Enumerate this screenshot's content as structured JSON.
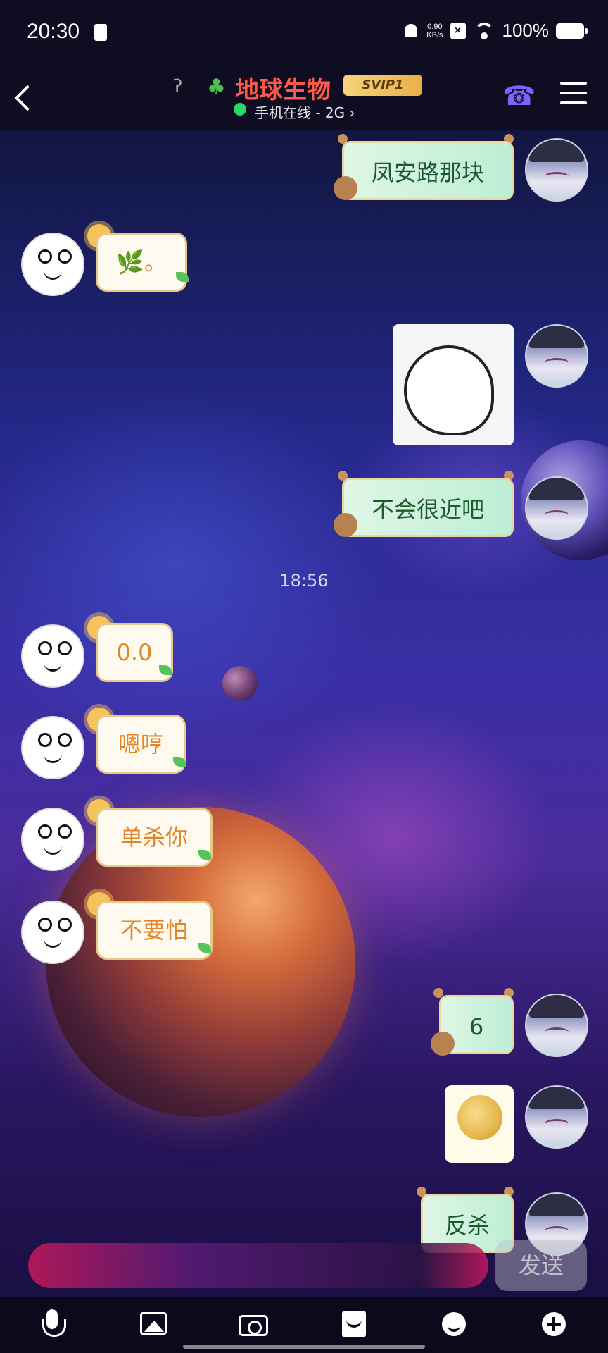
{
  "status_bar": {
    "time": "20:30",
    "net_speed_value": "0.90",
    "net_speed_unit": "KB/s",
    "battery": "100%"
  },
  "header": {
    "title": "地球生物",
    "badge": "SVIP1",
    "presence": "手机在线 - 2G ›",
    "presence_color": "#2ed36d",
    "title_color": "#ff5a4a"
  },
  "messages": [
    {
      "side": "right",
      "type": "text",
      "text": "凤安路那块"
    },
    {
      "side": "left",
      "type": "text",
      "text": "🌿。"
    },
    {
      "side": "right",
      "type": "sticker",
      "description": "sticker-image"
    },
    {
      "side": "right",
      "type": "text",
      "text": "不会很近吧"
    },
    {
      "side": "left",
      "type": "text",
      "text": "0.0"
    },
    {
      "side": "left",
      "type": "text",
      "text": "嗯哼"
    },
    {
      "side": "left",
      "type": "text",
      "text": "单杀你"
    },
    {
      "side": "left",
      "type": "text",
      "text": "不要怕"
    },
    {
      "side": "right",
      "type": "text",
      "text": "6"
    },
    {
      "side": "right",
      "type": "sticker",
      "description": "sticker-image"
    },
    {
      "side": "right",
      "type": "text",
      "text": "反杀"
    }
  ],
  "timestamp": "18:56",
  "composer": {
    "send_label": "发送"
  },
  "toolbar": {
    "icons": [
      "mic-icon",
      "image-icon",
      "camera-icon",
      "red-envelope-icon",
      "emoji-icon",
      "plus-icon"
    ]
  }
}
